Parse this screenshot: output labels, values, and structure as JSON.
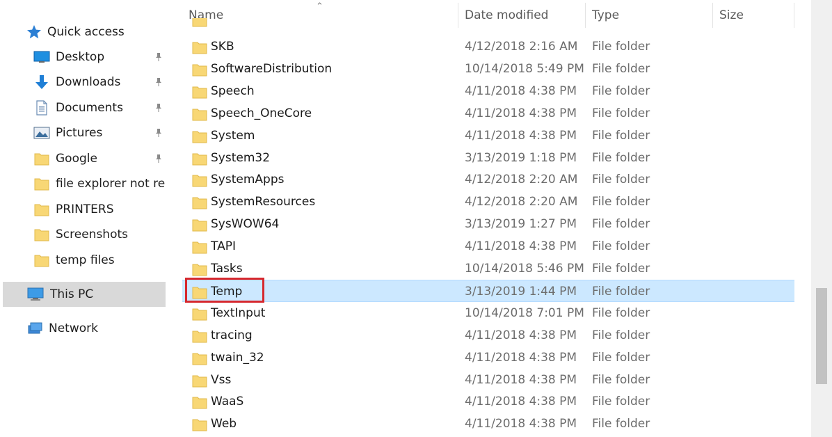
{
  "sidebar": {
    "quick_access": {
      "label": "Quick access",
      "icon": "star-icon"
    },
    "items": [
      {
        "label": "Desktop",
        "icon": "desktop-icon",
        "pinned": true
      },
      {
        "label": "Downloads",
        "icon": "download-arrow-icon",
        "pinned": true
      },
      {
        "label": "Documents",
        "icon": "document-icon",
        "pinned": true
      },
      {
        "label": "Pictures",
        "icon": "pictures-icon",
        "pinned": true
      },
      {
        "label": "Google",
        "icon": "folder-icon",
        "pinned": true
      },
      {
        "label": "file explorer not responding",
        "icon": "folder-icon",
        "pinned": false
      },
      {
        "label": "PRINTERS",
        "icon": "folder-icon",
        "pinned": false
      },
      {
        "label": "Screenshots",
        "icon": "folder-icon",
        "pinned": false
      },
      {
        "label": "temp files",
        "icon": "folder-icon",
        "pinned": false
      }
    ],
    "this_pc": {
      "label": "This PC",
      "icon": "computer-icon"
    },
    "network": {
      "label": "Network",
      "icon": "network-icon"
    }
  },
  "columns": {
    "name": "Name",
    "date": "Date modified",
    "type": "Type",
    "size": "Size"
  },
  "files": [
    {
      "name": "SKB",
      "date": "4/12/2018 2:16 AM",
      "type": "File folder"
    },
    {
      "name": "SoftwareDistribution",
      "date": "10/14/2018 5:49 PM",
      "type": "File folder"
    },
    {
      "name": "Speech",
      "date": "4/11/2018 4:38 PM",
      "type": "File folder"
    },
    {
      "name": "Speech_OneCore",
      "date": "4/11/2018 4:38 PM",
      "type": "File folder"
    },
    {
      "name": "System",
      "date": "4/11/2018 4:38 PM",
      "type": "File folder"
    },
    {
      "name": "System32",
      "date": "3/13/2019 1:18 PM",
      "type": "File folder"
    },
    {
      "name": "SystemApps",
      "date": "4/12/2018 2:20 AM",
      "type": "File folder"
    },
    {
      "name": "SystemResources",
      "date": "4/12/2018 2:20 AM",
      "type": "File folder"
    },
    {
      "name": "SysWOW64",
      "date": "3/13/2019 1:27 PM",
      "type": "File folder"
    },
    {
      "name": "TAPI",
      "date": "4/11/2018 4:38 PM",
      "type": "File folder"
    },
    {
      "name": "Tasks",
      "date": "10/14/2018 5:46 PM",
      "type": "File folder"
    },
    {
      "name": "Temp",
      "date": "3/13/2019 1:44 PM",
      "type": "File folder",
      "selected": true
    },
    {
      "name": "TextInput",
      "date": "10/14/2018 7:01 PM",
      "type": "File folder"
    },
    {
      "name": "tracing",
      "date": "4/11/2018 4:38 PM",
      "type": "File folder"
    },
    {
      "name": "twain_32",
      "date": "4/11/2018 4:38 PM",
      "type": "File folder"
    },
    {
      "name": "Vss",
      "date": "4/11/2018 4:38 PM",
      "type": "File folder"
    },
    {
      "name": "WaaS",
      "date": "4/11/2018 4:38 PM",
      "type": "File folder"
    },
    {
      "name": "Web",
      "date": "4/11/2018 4:38 PM",
      "type": "File folder"
    }
  ],
  "colors": {
    "selection": "#cce8ff",
    "highlight_box": "#d6282e",
    "folder": "#f8d775",
    "accent": "#0f7bd8"
  }
}
